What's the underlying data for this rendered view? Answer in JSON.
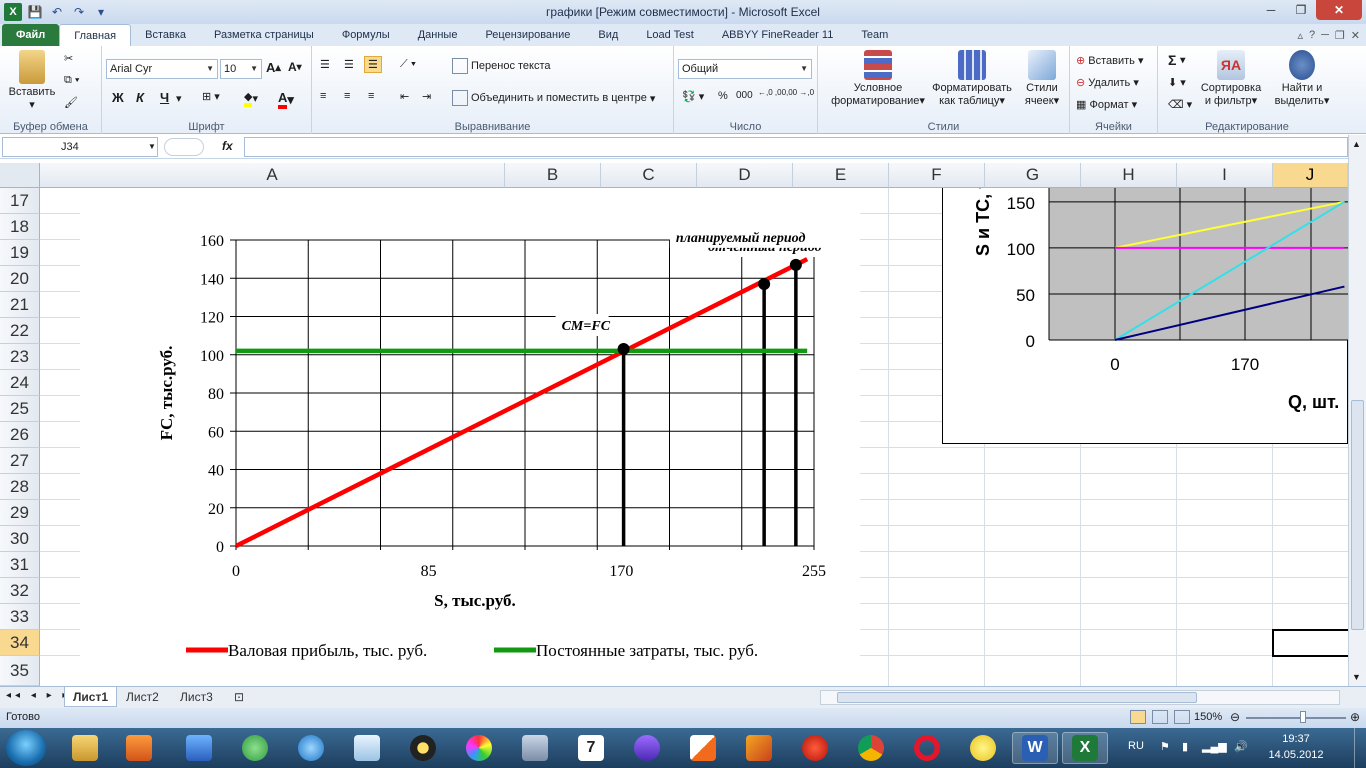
{
  "window": {
    "title": "графики  [Режим совместимости]  -  Microsoft Excel"
  },
  "tabs": [
    "Главная",
    "Вставка",
    "Разметка страницы",
    "Формулы",
    "Данные",
    "Рецензирование",
    "Вид",
    "Load Test",
    "ABBYY FineReader 11",
    "Team"
  ],
  "file_tab": "Файл",
  "ribbon": {
    "clipboard": {
      "label": "Буфер обмена",
      "paste": "Вставить"
    },
    "font": {
      "label": "Шрифт",
      "name": "Arial Cyr",
      "size": "10",
      "bold": "Ж",
      "italic": "К",
      "underline": "Ч"
    },
    "alignment": {
      "label": "Выравнивание",
      "wrap": "Перенос текста",
      "merge": "Объединить и поместить в центре"
    },
    "number": {
      "label": "Число",
      "format": "Общий",
      "percent": "%",
      "thousands": "000",
      "inc_dec": "←,0 ,00",
      "dec_dec": ",00 →,0"
    },
    "styles": {
      "label": "Стили",
      "cond_1": "Условное",
      "cond_2": "форматирование",
      "table_1": "Форматировать",
      "table_2": "как таблицу",
      "cell_1": "Стили",
      "cell_2": "ячеек"
    },
    "cells": {
      "label": "Ячейки",
      "insert": "Вставить",
      "delete": "Удалить",
      "format": "Формат"
    },
    "editing": {
      "label": "Редактирование",
      "sort_1": "Сортировка",
      "sort_2": "и фильтр",
      "find_1": "Найти и",
      "find_2": "выделить",
      "sigma": "Σ"
    }
  },
  "formula_bar": {
    "name_box": "J34",
    "fx": "fx",
    "value": ""
  },
  "columns": [
    "A",
    "B",
    "C",
    "D",
    "E",
    "F",
    "G",
    "H",
    "I",
    "J"
  ],
  "rows": [
    "17",
    "18",
    "19",
    "20",
    "21",
    "22",
    "23",
    "24",
    "25",
    "26",
    "27",
    "28",
    "29",
    "30",
    "31",
    "32",
    "33",
    "34",
    "35"
  ],
  "selected_cell": "J34",
  "chart_data": [
    {
      "type": "line",
      "xlabel": "S, тыс.руб.",
      "ylabel": "FC, тыс.руб.",
      "x_ticks": [
        "0",
        "85",
        "170",
        "255"
      ],
      "y_ticks": [
        "0",
        "20",
        "40",
        "60",
        "80",
        "100",
        "120",
        "140",
        "160"
      ],
      "xlim": [
        0,
        255
      ],
      "ylim": [
        0,
        160
      ],
      "grid": true,
      "legend_position": "bottom",
      "series": [
        {
          "name": "Валовая прибыль, тыс. руб.",
          "color": "#ff0000",
          "x": [
            0,
            252
          ],
          "y": [
            0,
            150
          ]
        },
        {
          "name": "Постоянные затраты, тыс. руб.",
          "color": "#119911",
          "x": [
            0,
            252
          ],
          "y": [
            102,
            102
          ]
        }
      ],
      "points": [
        {
          "label": "CM=FC",
          "x": 171,
          "y": 103
        },
        {
          "label": "отчетный период",
          "x": 233,
          "y": 137
        },
        {
          "label": "планируемый период",
          "x": 247,
          "y": 147
        }
      ]
    },
    {
      "type": "line",
      "xlabel": "Q, шт.",
      "ylabel": "S и ТС, т",
      "x_ticks": [
        "0",
        "170"
      ],
      "y_ticks": [
        "0",
        "50",
        "100",
        "150"
      ],
      "grid": true,
      "plot_background": "#c0c0c0",
      "series": [
        {
          "color": "#ffff33",
          "x": [
            0,
            300
          ],
          "y": [
            100,
            150
          ]
        },
        {
          "color": "#ff00ff",
          "x": [
            0,
            300
          ],
          "y": [
            100,
            100
          ]
        },
        {
          "color": "#33e0e8",
          "x": [
            0,
            300
          ],
          "y": [
            0,
            150
          ]
        },
        {
          "color": "#000080",
          "x": [
            0,
            300
          ],
          "y": [
            0,
            58
          ]
        }
      ]
    }
  ],
  "sheets": [
    "Лист1",
    "Лист2",
    "Лист3"
  ],
  "status": {
    "ready": "Готово",
    "zoom": "150%"
  },
  "tray": {
    "lang": "RU",
    "time": "19:37",
    "date": "14.05.2012"
  }
}
